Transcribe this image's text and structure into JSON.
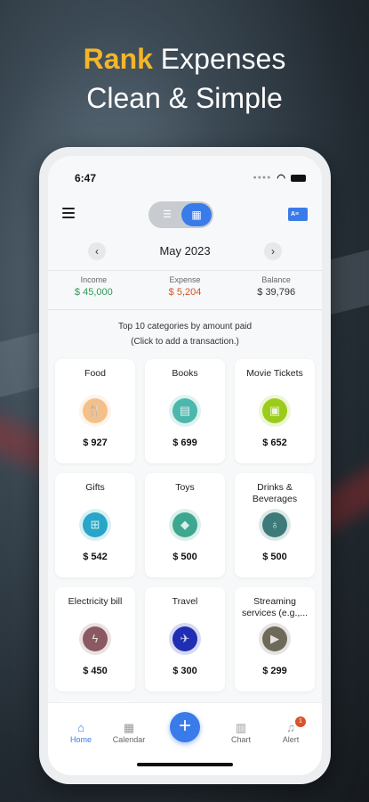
{
  "headline": {
    "accent": "Rank",
    "line1_rest": " Expenses",
    "line2": "Clean & Simple"
  },
  "status_bar": {
    "time": "6:47"
  },
  "month": {
    "label": "May 2023",
    "prev_icon": "chevron-left-icon",
    "next_icon": "chevron-right-icon"
  },
  "summary": [
    {
      "label": "Income",
      "value": "$ 45,000",
      "color": "#2e9a5a"
    },
    {
      "label": "Expense",
      "value": "$ 5,204",
      "color": "#d9522a"
    },
    {
      "label": "Balance",
      "value": "$ 39,796",
      "color": "#333333"
    }
  ],
  "caption": {
    "line1": "Top 10 categories by amount paid",
    "line2": "(Click to add a transaction.)"
  },
  "categories": [
    {
      "name": "Food",
      "amount": "$ 927",
      "icon": "fork-knife-icon",
      "color": "#f5c08a"
    },
    {
      "name": "Books",
      "amount": "$ 699",
      "icon": "book-icon",
      "color": "#4bb7ae"
    },
    {
      "name": "Movie Tickets",
      "amount": "$ 652",
      "icon": "ticket-icon",
      "color": "#9ccc1a"
    },
    {
      "name": "Gifts",
      "amount": "$ 542",
      "icon": "gift-icon",
      "color": "#29a6c9"
    },
    {
      "name": "Toys",
      "amount": "$ 500",
      "icon": "toy-icon",
      "color": "#3ea98f"
    },
    {
      "name": "Drinks & Beverages",
      "amount": "$ 500",
      "icon": "drink-icon",
      "color": "#3f7b7a"
    },
    {
      "name": "Electricity bill",
      "amount": "$ 450",
      "icon": "lightning-icon",
      "color": "#8b5a63"
    },
    {
      "name": "Travel",
      "amount": "$ 300",
      "icon": "airplane-icon",
      "color": "#1f2fb3"
    },
    {
      "name": "Streaming services (e.g.,...",
      "amount": "$ 299",
      "icon": "play-icon",
      "color": "#6f6a5a"
    }
  ],
  "tabs": [
    {
      "label": "Home",
      "icon": "home-icon",
      "active": true
    },
    {
      "label": "Calendar",
      "icon": "calendar-icon"
    },
    {
      "label": "Chart",
      "icon": "bar-chart-icon"
    },
    {
      "label": "Alert",
      "icon": "bell-icon",
      "badge": "1"
    }
  ],
  "fab": {
    "label": "+"
  },
  "colors": {
    "accent": "#3a7bea",
    "headline_accent": "#f3b52a"
  }
}
